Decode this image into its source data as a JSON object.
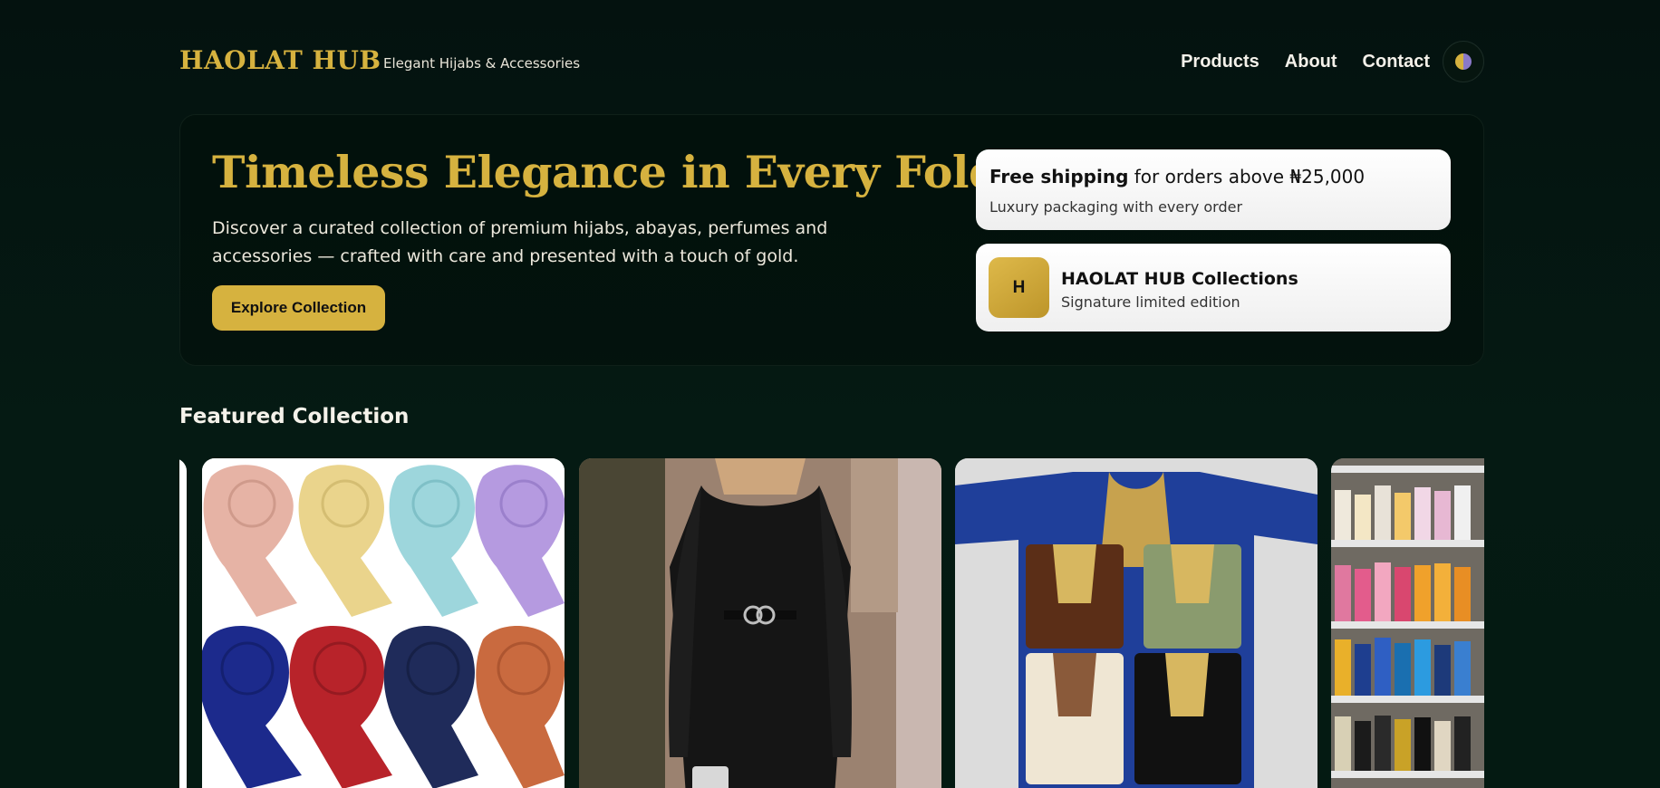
{
  "header": {
    "brand": "HAOLAT HUB",
    "tagline": "Elegant Hijabs & Accessories",
    "nav": [
      "Products",
      "About",
      "Contact"
    ],
    "theme_icon": "half-circle-theme-icon"
  },
  "hero": {
    "title": "Timeless Elegance in Every Fold",
    "subtitle": "Discover a curated collection of premium hijabs, abayas, perfumes and accessories — crafted with care and presented with a touch of gold.",
    "cta": "Explore Collection"
  },
  "shipping_card": {
    "strong": "Free shipping",
    "rest": " for orders above ₦25,000",
    "note": "Luxury packaging with every order"
  },
  "collection_card": {
    "logo_letter": "H",
    "title": "HAOLAT HUB Collections",
    "subtitle": "Signature limited edition"
  },
  "featured": {
    "title": "Featured Collection",
    "items": [
      {
        "image": "colorful-rolled-hijabs-photo"
      },
      {
        "image": "black-abaya-model-photo"
      },
      {
        "image": "embroidered-kaftans-photo"
      },
      {
        "image": "store-shelves-products-photo"
      }
    ]
  },
  "colors": {
    "background": "#04140f",
    "gold": "#d6b23f",
    "text": "#f3efe4"
  }
}
